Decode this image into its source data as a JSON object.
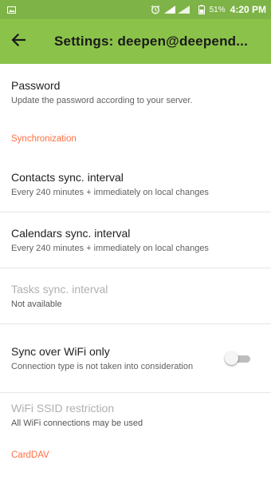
{
  "status_bar": {
    "battery_percent": "51%",
    "time": "4:20 PM",
    "left_icon": "image-icon",
    "right_icons": [
      "alarm-icon",
      "signal-icon",
      "battery-icon"
    ]
  },
  "app_bar": {
    "title": "Settings: deepen@deepend...",
    "back_icon": "arrow-back-icon",
    "color": "#8bc34a"
  },
  "items": {
    "password": {
      "title": "Password",
      "summary": "Update the password according to your server."
    },
    "sync_category": "Synchronization",
    "contacts": {
      "title": "Contacts sync. interval",
      "summary": "Every 240 minutes + immediately on local changes"
    },
    "calendars": {
      "title": "Calendars sync. interval",
      "summary": "Every 240 minutes + immediately on local changes"
    },
    "tasks": {
      "title": "Tasks sync. interval",
      "summary": "Not available"
    },
    "wifi_only": {
      "title": "Sync over WiFi only",
      "summary": "Connection type is not taken into consideration",
      "enabled": false
    },
    "ssid": {
      "title": "WiFi SSID restriction",
      "summary": "All WiFi connections may be used"
    },
    "carddav_category": "CardDAV"
  },
  "colors": {
    "accent": "#ff7043",
    "statusbar": "#7db347"
  }
}
